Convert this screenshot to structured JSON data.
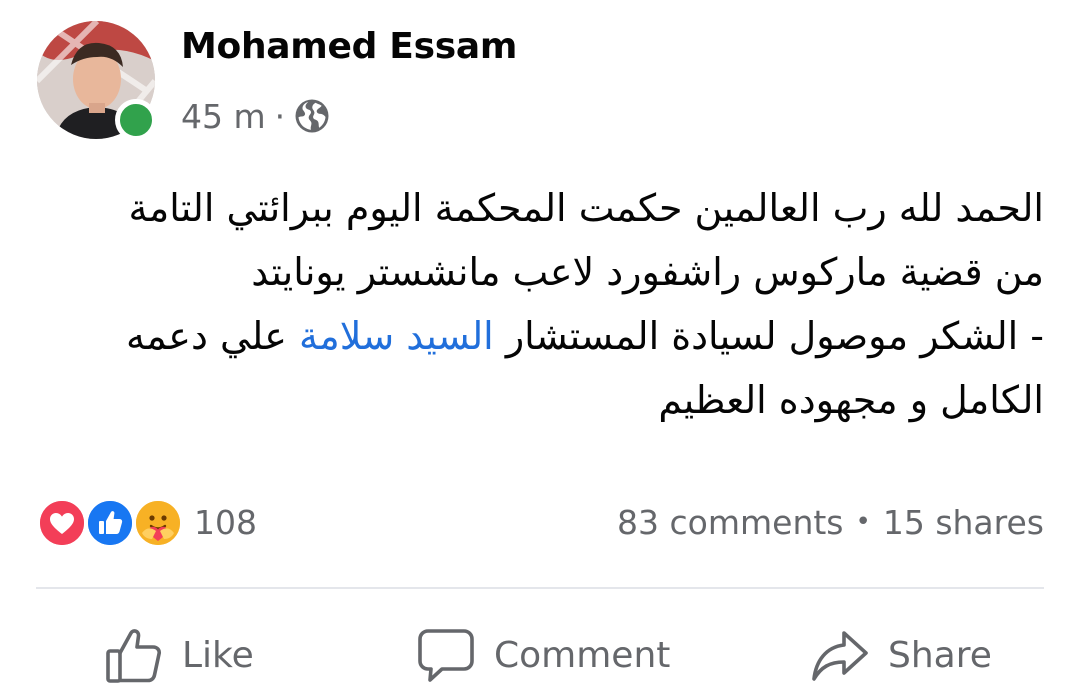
{
  "post": {
    "author_name": "Mohamed Essam",
    "timestamp": "45 m",
    "separator": "·",
    "privacy_icon": "globe-icon",
    "online": true,
    "text_lines": {
      "line1": "الحمد لله رب العالمين حكمت المحكمة اليوم ببرائتي التامة",
      "line2": "من قضية ماركوس راشفورد لاعب مانشستر يونايتد",
      "line3_before": "- الشكر موصول لسيادة المستشار ",
      "line3_mention": "السيد سلامة",
      "line3_after": " علي دعمه",
      "line4": "الكامل و مجهوده العظيم"
    }
  },
  "engagement": {
    "reaction_icons": [
      "love-reaction-icon",
      "like-reaction-icon",
      "care-reaction-icon"
    ],
    "reaction_count": "108",
    "comments": "83 comments",
    "dot": "•",
    "shares": "15 shares"
  },
  "actions": {
    "like_label": "Like",
    "comment_label": "Comment",
    "share_label": "Share"
  },
  "colors": {
    "mention": "#216fdb",
    "muted_text": "#65676b",
    "online": "#31a24c",
    "like_blue": "#1877f2",
    "love_red": "#f33e58",
    "care_yellow": "#f7b125"
  }
}
